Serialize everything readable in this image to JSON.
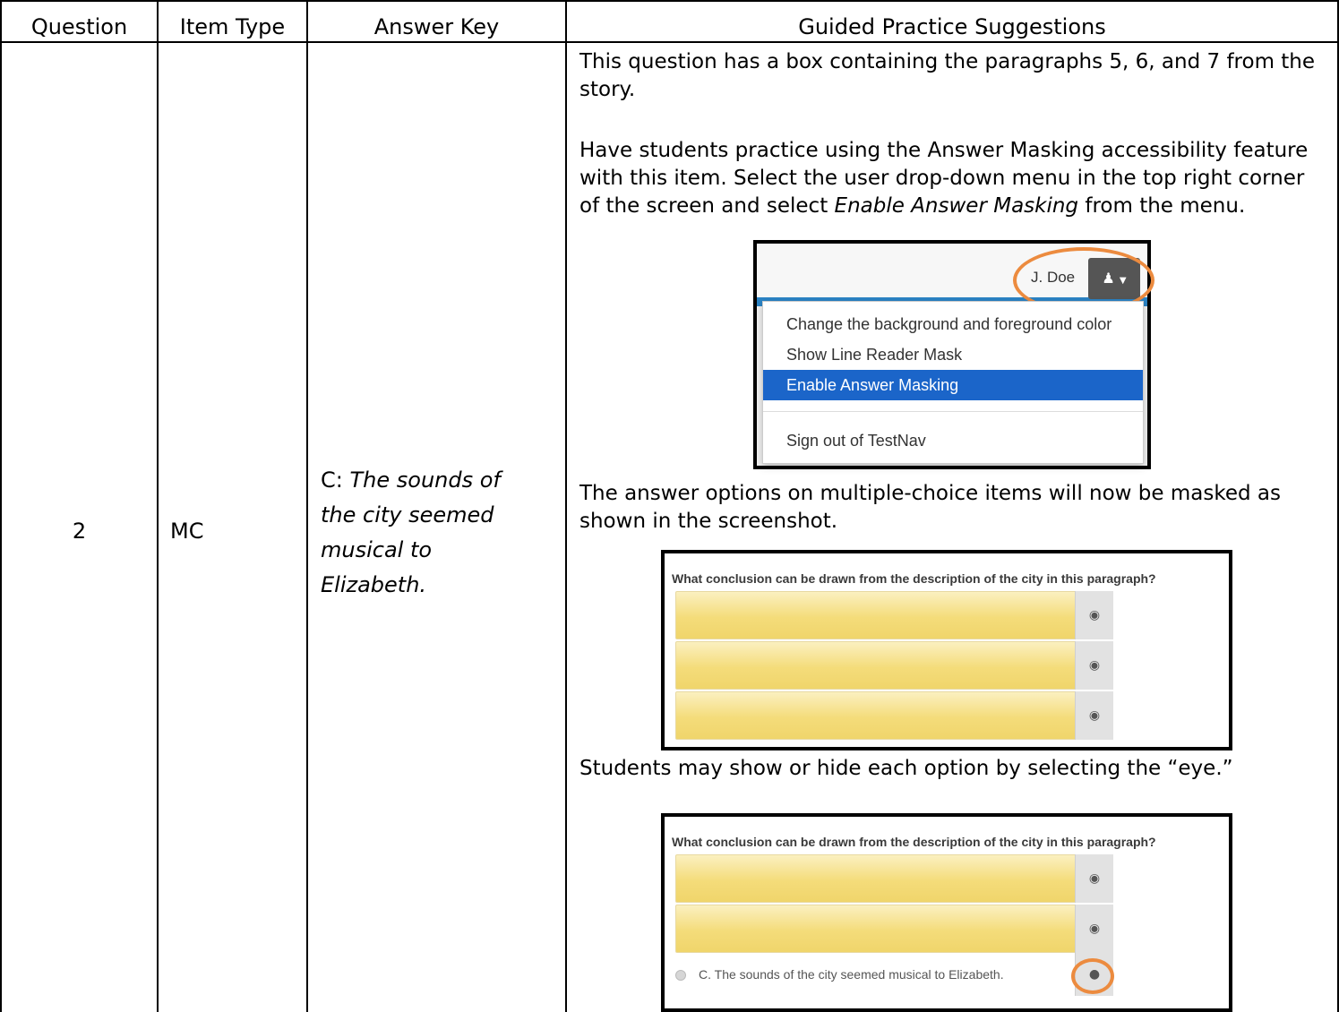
{
  "table": {
    "headers": [
      "Question",
      "Item Type",
      "Answer Key",
      "Guided Practice Suggestions"
    ],
    "row": {
      "question": "2",
      "item_type": "MC",
      "answer_key_letter": "C:",
      "answer_key_text": "The sounds of the city seemed musical to Elizabeth.",
      "suggestions": {
        "p1": "This question has a box containing the paragraphs 5, 6, and 7 from the story.",
        "p2_before": "Have students practice using the Answer Masking accessibility feature with this item.  Select the user drop-down menu in the top right corner of the screen and select ",
        "p2_italic": "Enable Answer Masking",
        "p2_after": " from the menu.",
        "p3": "The answer options on multiple-choice items will now be masked as shown in the screenshot.",
        "p4": "Students may show or hide each option by selecting the “eye.”"
      }
    }
  },
  "menu_screenshot": {
    "user_name": "J. Doe",
    "user_icon": "user-icon",
    "items": [
      "Change the background and foreground color",
      "Show Line Reader Mask",
      "Enable Answer Masking",
      "Sign out of TestNav"
    ],
    "selected_item": "Enable Answer Masking",
    "highlight_color": "#1b65c9",
    "circle_color": "#ec8b3f"
  },
  "masked_screenshot": {
    "question": "What conclusion can be drawn from the description of the city in this paragraph?",
    "masked_options": 3,
    "eye_icon": "eye-slash-icon"
  },
  "revealed_screenshot": {
    "question": "What conclusion can be drawn from the description of the city in this paragraph?",
    "masked_options": 2,
    "revealed_option": "C.  The sounds of the city seemed musical to Elizabeth.",
    "eye_icon": "eye-icon"
  }
}
